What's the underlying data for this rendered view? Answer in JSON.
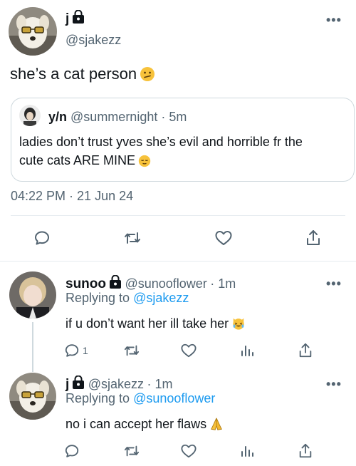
{
  "main_tweet": {
    "name": "j",
    "handle": "@sjakezz",
    "text": "she’s a cat person",
    "emoji": "face-with-diagonal-mouth",
    "timestamp": "04:22 PM · 21 Jun 24",
    "quoted": {
      "name": "y/n",
      "handle": "@summernight",
      "time": "· 5m",
      "text_line1": "ladies don’t trust yves she’s evil and horrible fr the",
      "text_line2": "cute cats ARE MINE",
      "emoji": "relieved-face"
    }
  },
  "replies": [
    {
      "name": "sunoo",
      "handle": "@sunooflower",
      "time": "· 1m",
      "replying_prefix": "Replying to",
      "replying_to": "@sjakezz",
      "text": "if u don’t want her ill take her",
      "emoji": "crying-laughing-cat",
      "reply_count": "1"
    },
    {
      "name": "j",
      "handle": "@sjakezz",
      "time": "· 1m",
      "replying_prefix": "Replying to",
      "replying_to": "@sunooflower",
      "text": "no i can accept her flaws",
      "emoji": "folded-hands",
      "reply_count": ""
    }
  ],
  "more_label": "•••",
  "colors": {
    "text": "#0f1419",
    "muted": "#536471",
    "link": "#1d9bf0",
    "border": "#cfd9de"
  }
}
